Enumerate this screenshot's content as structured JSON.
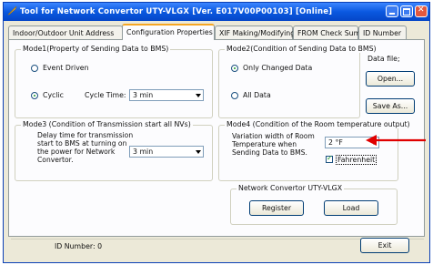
{
  "window": {
    "title": "Tool for Network Convertor UTY-VLGX [Ver. E017V00P00103] [Online]"
  },
  "tabs": [
    {
      "label": "Indoor/Outdoor Unit Address"
    },
    {
      "label": "Configuration Properties",
      "active": true
    },
    {
      "label": "XIF Making/Modifying"
    },
    {
      "label": "FROM Check Sum"
    },
    {
      "label": "ID Number"
    }
  ],
  "mode1": {
    "legend": "Mode1(Property of Sending Data to BMS)",
    "option_event": "Event Driven",
    "option_cyclic": "Cyclic",
    "selected": "Cyclic",
    "cycle_time_label": "Cycle Time:",
    "cycle_time_value": "3 min"
  },
  "mode2": {
    "legend": "Mode2(Condition of Sending Data to BMS)",
    "option_changed": "Only Changed Data",
    "option_all": "All Data",
    "selected": "Only Changed Data"
  },
  "datafile": {
    "label": "Data file;",
    "open_button": "Open...",
    "saveas_button": "Save As..."
  },
  "mode3": {
    "legend": "Mode3 (Condition of Transmission start all NVs)",
    "description_lines": [
      "Delay time for transmission",
      "start to BMS at turning on",
      "the power for Network",
      "Convertor."
    ],
    "delay_value": "3 min"
  },
  "mode4": {
    "legend": "Mode4 (Condition of the Room temperature output)",
    "description_lines": [
      "Variation width of Room",
      "Temperature when",
      "Sending Data to BMS."
    ],
    "variation_value": "2 °F",
    "fahrenheit_label": "Fahrenheit",
    "fahrenheit_checked": true
  },
  "convertor": {
    "legend": "Network Convertor UTY-VLGX",
    "register_button": "Register",
    "load_button": "Load"
  },
  "footer": {
    "id_number_label": "ID Number:  0",
    "exit_button": "Exit"
  },
  "colors": {
    "titlebar": "#0a58e0",
    "window_bg": "#ece9d8",
    "active_tab_accent": "#f5a623",
    "annotation_arrow": "#e00000"
  }
}
